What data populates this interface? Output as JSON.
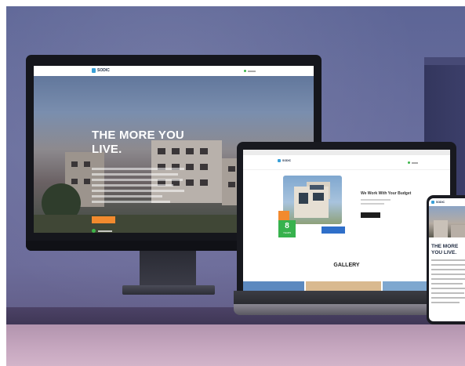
{
  "brand": {
    "name": "SODIC",
    "accent_blue": "#3aa0d8",
    "accent_green": "#37b24d",
    "accent_orange": "#f28a2e"
  },
  "desktop_site": {
    "logo_text": "SODIC",
    "hero_title_line1": "THE MORE YOU",
    "hero_title_line2": "LIVE."
  },
  "laptop_site": {
    "logo_text": "SODIC",
    "section_heading": "We Work With Your Budget",
    "experience_number": "8",
    "experience_label": "YEARS",
    "gallery_heading": "GALLERY"
  },
  "phone_site": {
    "logo_text": "SODIC",
    "hero_title_line1": "THE MORE",
    "hero_title_line2": "YOU LIVE."
  },
  "icons": [
    "logo-icon",
    "phone-call-icon"
  ]
}
